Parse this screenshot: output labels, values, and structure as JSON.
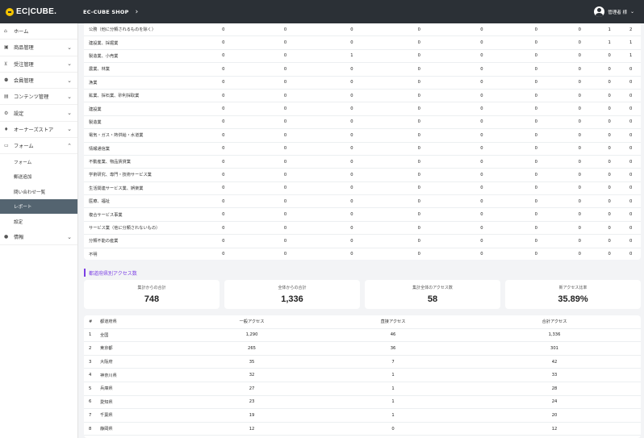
{
  "header": {
    "logo_text": "EC|CUBE.",
    "shop_name": "EC-CUBE SHOP",
    "user_name": "管理者 様"
  },
  "sidebar": {
    "items": [
      {
        "icon": "home-icon",
        "glyph": "⌂",
        "label": "ホーム",
        "arrow": ""
      },
      {
        "icon": "box-icon",
        "glyph": "▣",
        "label": "商品管理",
        "arrow": "⌄"
      },
      {
        "icon": "cart-icon",
        "glyph": "⊻",
        "label": "受注管理",
        "arrow": "⌄"
      },
      {
        "icon": "users-icon",
        "glyph": "⚉",
        "label": "会員管理",
        "arrow": "⌄"
      },
      {
        "icon": "file-icon",
        "glyph": "▤",
        "label": "コンテンツ管理",
        "arrow": "⌄"
      },
      {
        "icon": "gear-icon",
        "glyph": "⚙",
        "label": "設定",
        "arrow": "⌄"
      },
      {
        "icon": "plug-icon",
        "glyph": "♦",
        "label": "オーナーズストア",
        "arrow": "⌄"
      },
      {
        "icon": "form-icon",
        "glyph": "▭",
        "label": "フォーム",
        "arrow": "⌃"
      }
    ],
    "subitems": [
      {
        "label": "フォーム",
        "active": false
      },
      {
        "label": "郵送追加",
        "active": false
      },
      {
        "label": "問い合わせ一覧",
        "active": false
      },
      {
        "label": "レポート",
        "active": true
      },
      {
        "label": "設定",
        "active": false
      }
    ],
    "bottom_item": {
      "icon": "info-icon",
      "glyph": "●",
      "label": "情報",
      "arrow": "⌄"
    }
  },
  "table1": {
    "rows": [
      {
        "name": "公務（他に分類されるものを除く）",
        "vals": [
          "0",
          "0",
          "0",
          "0",
          "0",
          "0",
          "0",
          "1",
          "2"
        ]
      },
      {
        "name": "建設業、採掘業",
        "vals": [
          "0",
          "0",
          "0",
          "0",
          "0",
          "0",
          "0",
          "1",
          "1"
        ]
      },
      {
        "name": "製造業、小売業",
        "vals": [
          "0",
          "0",
          "1",
          "0",
          "0",
          "0",
          "0",
          "0",
          "1"
        ]
      },
      {
        "name": "農業、林業",
        "vals": [
          "0",
          "0",
          "0",
          "0",
          "0",
          "0",
          "0",
          "0",
          "0"
        ]
      },
      {
        "name": "漁業",
        "vals": [
          "0",
          "0",
          "0",
          "0",
          "0",
          "0",
          "0",
          "0",
          "0"
        ]
      },
      {
        "name": "鉱業、採石業、砂利採取業",
        "vals": [
          "0",
          "0",
          "0",
          "0",
          "0",
          "0",
          "0",
          "0",
          "0"
        ]
      },
      {
        "name": "建設業",
        "vals": [
          "0",
          "0",
          "0",
          "0",
          "0",
          "0",
          "0",
          "0",
          "0"
        ]
      },
      {
        "name": "製造業",
        "vals": [
          "0",
          "0",
          "0",
          "0",
          "0",
          "0",
          "0",
          "0",
          "0"
        ]
      },
      {
        "name": "電気・ガス・熱供給・水道業",
        "vals": [
          "0",
          "0",
          "0",
          "0",
          "0",
          "0",
          "0",
          "0",
          "0"
        ]
      },
      {
        "name": "情報通信業",
        "vals": [
          "0",
          "0",
          "0",
          "0",
          "0",
          "0",
          "0",
          "0",
          "0"
        ]
      },
      {
        "name": "不動産業、物品賃貸業",
        "vals": [
          "0",
          "0",
          "0",
          "0",
          "0",
          "0",
          "0",
          "0",
          "0"
        ]
      },
      {
        "name": "学術研究、専門・技術サービス業",
        "vals": [
          "0",
          "0",
          "0",
          "0",
          "0",
          "0",
          "0",
          "0",
          "0"
        ]
      },
      {
        "name": "生活関連サービス業、娯楽業",
        "vals": [
          "0",
          "0",
          "0",
          "0",
          "0",
          "0",
          "0",
          "0",
          "0"
        ]
      },
      {
        "name": "医療、福祉",
        "vals": [
          "0",
          "0",
          "0",
          "0",
          "0",
          "0",
          "0",
          "0",
          "0"
        ]
      },
      {
        "name": "複合サービス事業",
        "vals": [
          "0",
          "0",
          "0",
          "0",
          "0",
          "0",
          "0",
          "0",
          "0"
        ]
      },
      {
        "name": "サービス業（他に分類されないもの）",
        "vals": [
          "0",
          "0",
          "0",
          "0",
          "0",
          "0",
          "0",
          "0",
          "0"
        ]
      },
      {
        "name": "分類不能の産業",
        "vals": [
          "0",
          "0",
          "0",
          "0",
          "0",
          "0",
          "0",
          "0",
          "0"
        ]
      },
      {
        "name": "不明",
        "vals": [
          "0",
          "0",
          "0",
          "0",
          "0",
          "0",
          "0",
          "0",
          "0"
        ]
      }
    ]
  },
  "section_title": "都道府県別アクセス数",
  "cards": [
    {
      "label": "集計からの合計",
      "value": "748"
    },
    {
      "label": "全体からの合計",
      "value": "1,336"
    },
    {
      "label": "集計全体のアクセス数",
      "value": "58"
    },
    {
      "label": "新アクセス比率",
      "value": "35.89%"
    }
  ],
  "table2": {
    "headers": [
      "#",
      "都道府県",
      "一般アクセス",
      "直接アクセス",
      "合計アクセス"
    ],
    "rows": [
      [
        "1",
        "全国",
        "1,290",
        "46",
        "1,336"
      ],
      [
        "2",
        "東京都",
        "265",
        "36",
        "301"
      ],
      [
        "3",
        "大阪府",
        "35",
        "7",
        "42"
      ],
      [
        "4",
        "神奈川県",
        "32",
        "1",
        "33"
      ],
      [
        "5",
        "兵庫県",
        "27",
        "1",
        "28"
      ],
      [
        "6",
        "愛知県",
        "23",
        "1",
        "24"
      ],
      [
        "7",
        "千葉県",
        "19",
        "1",
        "20"
      ],
      [
        "8",
        "静岡県",
        "12",
        "0",
        "12"
      ]
    ]
  }
}
